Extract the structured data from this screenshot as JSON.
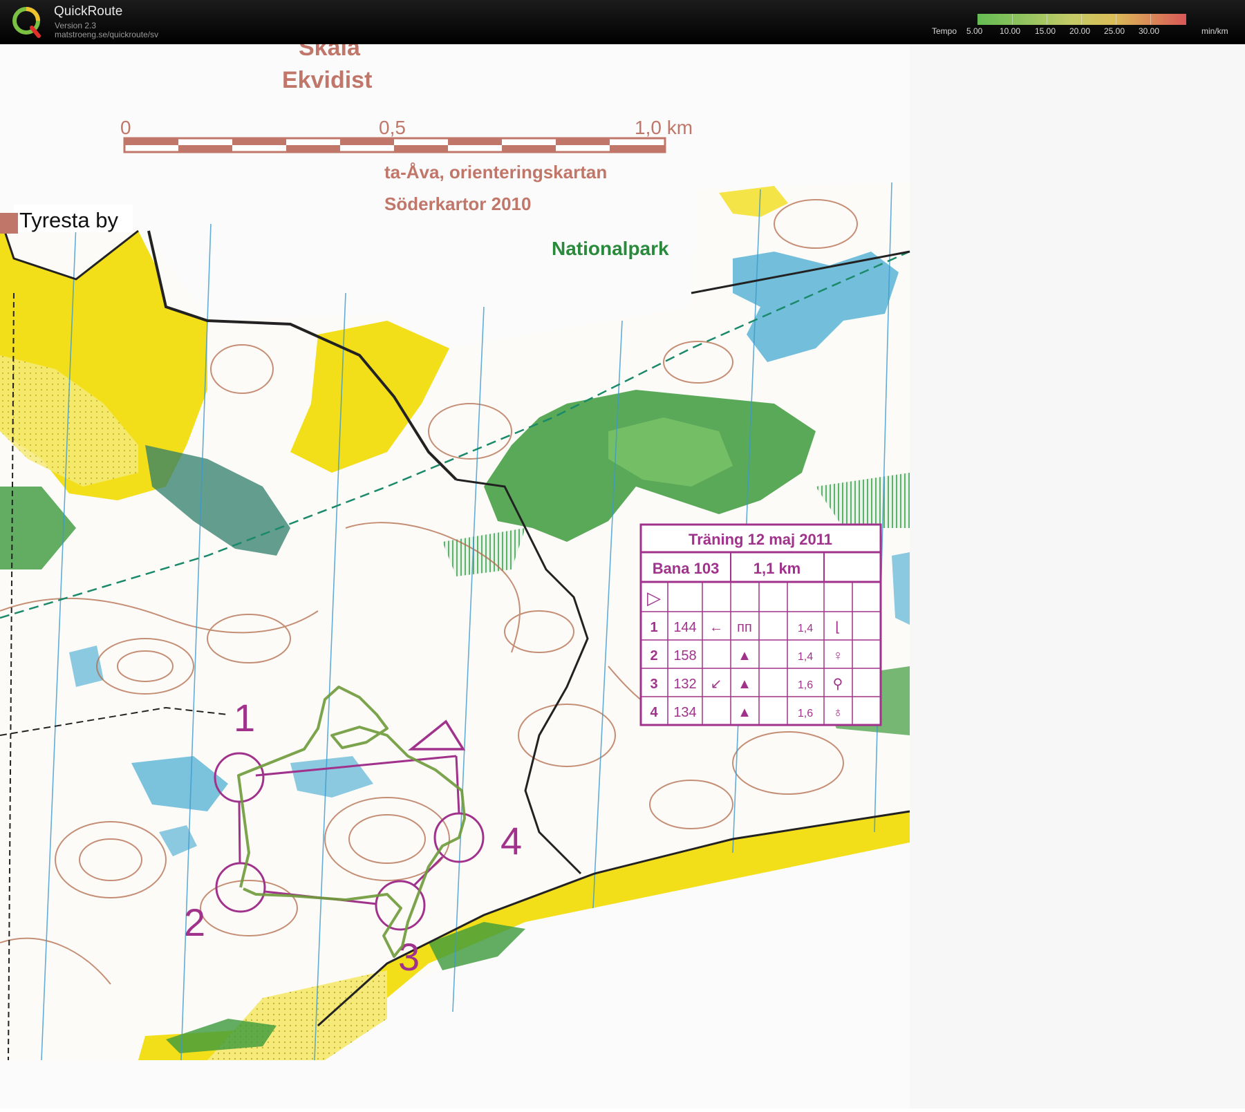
{
  "app": {
    "title": "QuickRoute",
    "version": "Version 2.3",
    "url": "matstroeng.se/quickroute/sv",
    "logo_letter": "Q"
  },
  "tempo": {
    "label": "Tempo",
    "ticks": [
      "5.00",
      "10.00",
      "15.00",
      "20.00",
      "25.00",
      "30.00"
    ],
    "unit": "min/km"
  },
  "map": {
    "scale_header_1": "Skala",
    "scale_header_2": "Ekvidist",
    "scale_labels": [
      "0",
      "0,5",
      "1,0 km"
    ],
    "map_title_1": "ta-Åva, orienteringskartan",
    "map_title_2": "Söderkartor 2010",
    "area_label": "Nationalpark",
    "place_label": "Tyresta by",
    "control_numbers": [
      "1",
      "2",
      "3",
      "4"
    ]
  },
  "description_sheet": {
    "title": "Träning 12 maj 2011",
    "course": "Bana 103",
    "length": "1,1 km",
    "start_symbol": "▷",
    "rows": [
      {
        "num": "1",
        "code": "144",
        "dir": "←",
        "feature": "ᴨᴨ",
        "dim": "1,4",
        "loc": "⌊"
      },
      {
        "num": "2",
        "code": "158",
        "dir": "",
        "feature": "▲",
        "dim": "1,4",
        "loc": "♀"
      },
      {
        "num": "3",
        "code": "132",
        "dir": "↙",
        "feature": "▲",
        "dim": "1,6",
        "loc": "⚲"
      },
      {
        "num": "4",
        "code": "134",
        "dir": "",
        "feature": "▲",
        "dim": "1,6",
        "loc": "♁"
      }
    ]
  },
  "colors": {
    "course": "#a0328c",
    "route": "#6e9a3a",
    "open_land": "#f2df1a",
    "green": "#3c9a3c",
    "water": "#5ab4d6",
    "contour": "#b26a4a",
    "scale_text": "#c0776a"
  }
}
